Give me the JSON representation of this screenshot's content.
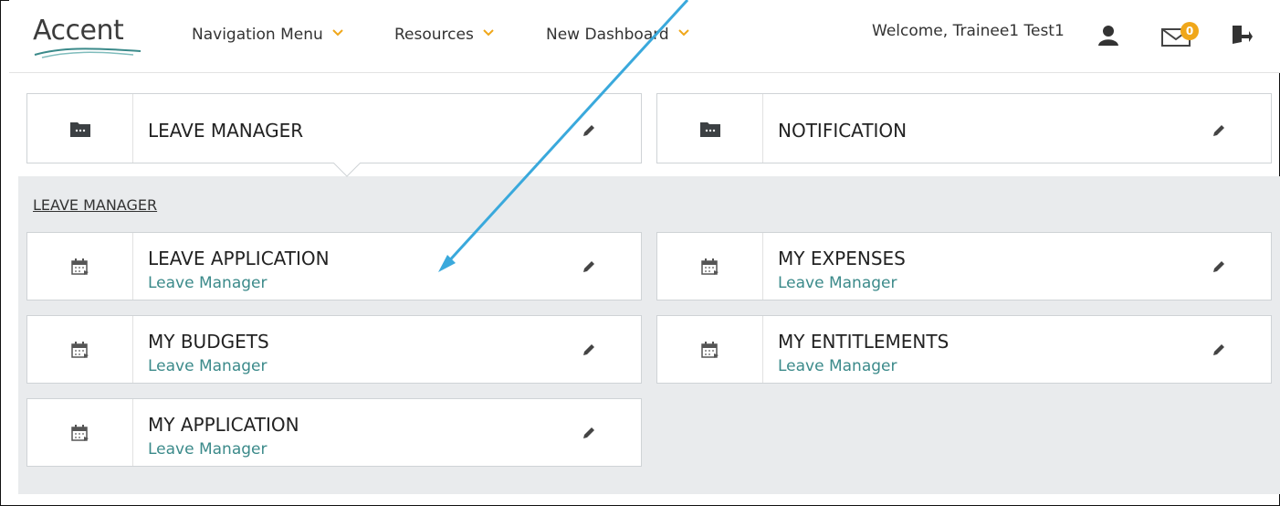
{
  "header": {
    "logo_text": "Accent",
    "nav": [
      {
        "label": "Navigation Menu"
      },
      {
        "label": "Resources"
      },
      {
        "label": "New Dashboard"
      }
    ],
    "welcome": "Welcome, Trainee1 Test1",
    "mail_count": "0"
  },
  "top_cards": [
    {
      "title": "LEAVE MANAGER",
      "icon": "folder-icon"
    },
    {
      "title": "NOTIFICATION",
      "icon": "folder-icon"
    }
  ],
  "panel": {
    "heading": "LEAVE MANAGER",
    "items": [
      {
        "title": "LEAVE APPLICATION",
        "subtitle": "Leave Manager",
        "icon": "calendar-icon"
      },
      {
        "title": "MY EXPENSES",
        "subtitle": "Leave Manager",
        "icon": "calendar-icon"
      },
      {
        "title": "MY BUDGETS",
        "subtitle": "Leave Manager",
        "icon": "calendar-icon"
      },
      {
        "title": "MY ENTITLEMENTS",
        "subtitle": "Leave Manager",
        "icon": "calendar-icon"
      },
      {
        "title": "MY APPLICATION",
        "subtitle": "Leave Manager",
        "icon": "calendar-icon"
      }
    ]
  },
  "colors": {
    "accent_orange": "#f0a71a",
    "subtitle_teal": "#3b8a8a",
    "panel_grey": "#e9ebed",
    "annotation_arrow": "#3aa9dc"
  }
}
